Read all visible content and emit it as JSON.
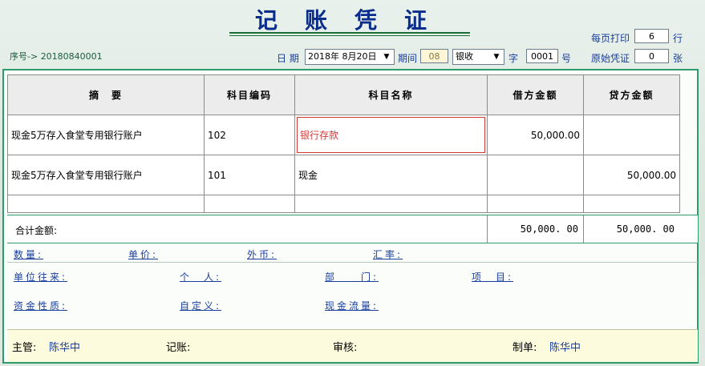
{
  "header": {
    "title": "记账凭证",
    "seq_label": "序号->",
    "seq_value": "20180840001",
    "date_label": "日 期",
    "date_value": "2018年 8月20日",
    "period_label": "期间",
    "period_value": "08",
    "voucher_type": "银收",
    "word_label": "字",
    "voucher_no": "0001",
    "no_label": "号",
    "print_label": "每页打印",
    "print_value": "6",
    "print_unit": "行",
    "orig_label": "原始凭证",
    "orig_value": "0",
    "orig_unit": "张"
  },
  "table": {
    "headers": [
      "摘　要",
      "科目编码",
      "科目名称",
      "借方金额",
      "贷方金额"
    ],
    "rows": [
      {
        "summary": "现金5万存入食堂专用银行账户",
        "code": "102",
        "name": "银行存款",
        "debit": "50,000.00",
        "credit": ""
      },
      {
        "summary": "现金5万存入食堂专用银行账户",
        "code": "101",
        "name": "现金",
        "debit": "",
        "credit": "50,000.00"
      }
    ],
    "total_label": "合计金额:",
    "total_debit": "50,000. 00",
    "total_credit": "50,000. 00"
  },
  "aux": {
    "quantity": "数量:",
    "unit_price": "单价:",
    "foreign": "外币:",
    "rate": "汇率:",
    "unit_contact": "单位往来:",
    "person": "个　人:",
    "department": "部　　门:",
    "project": "项　目:",
    "fund_nature": "资金性质:",
    "custom": "自定义:",
    "cash_flow": "现金流量:"
  },
  "footer": {
    "supervisor_label": "主管:",
    "supervisor": "陈华中",
    "bookkeeper_label": "记账:",
    "auditor_label": "审核:",
    "maker_label": "制单:",
    "maker": "陈华中"
  },
  "colors": {
    "title": "#0a2c8a",
    "link": "#1a3e9c",
    "frame": "#2c9c6c",
    "highlight": "#d23a3a"
  }
}
